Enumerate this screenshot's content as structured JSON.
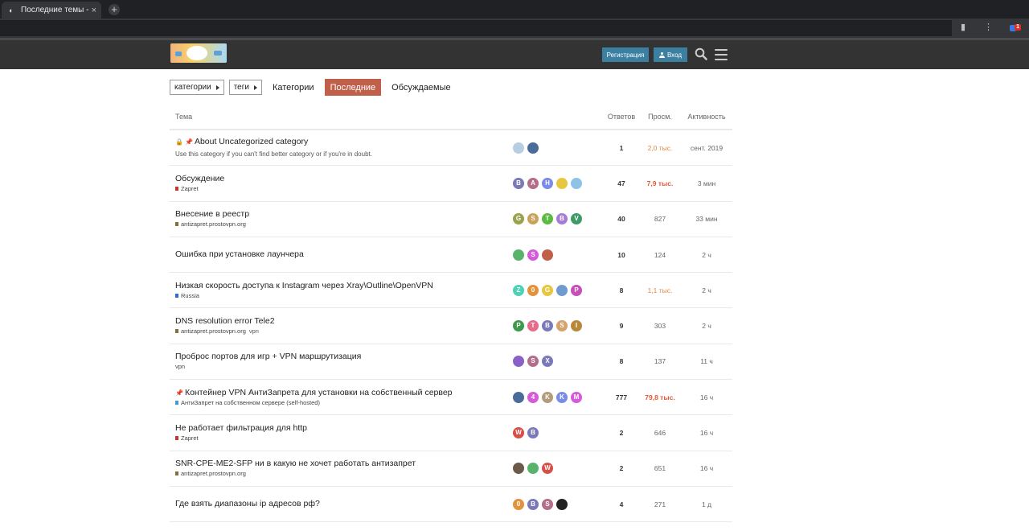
{
  "browser": {
    "tab_title": "Последние темы - NTC",
    "tab_close": "×",
    "new_tab": "+",
    "extension_count": "1"
  },
  "header": {
    "register_label": "Регистрация",
    "login_label": "Вход"
  },
  "nav": {
    "categories_dd": "категории",
    "tags_dd": "теги",
    "links": [
      "Категории",
      "Последние",
      "Обсуждаемые"
    ],
    "active_index": 1
  },
  "table": {
    "headers": {
      "topic": "Тема",
      "replies": "Ответов",
      "views": "Просм.",
      "activity": "Активность"
    },
    "rows": [
      {
        "title": "About Uncategorized category",
        "excerpt": "Use this category if you can't find better category or if you're in doubt.",
        "locked": true,
        "pinned": true,
        "category": "",
        "category_color": "",
        "tag": "",
        "posters": [
          {
            "letter": "",
            "color": "#b7cde3",
            "icon": "avatar-sketch"
          },
          {
            "letter": "",
            "color": "#4a6c9b",
            "icon": "avatar-anime"
          }
        ],
        "replies": "1",
        "views": "2,0 тыс.",
        "views_style": "warm",
        "activity": "сент. 2019"
      },
      {
        "title": "Обсуждение",
        "category": "Zapret",
        "category_color": "#c0392b",
        "posters": [
          {
            "letter": "B",
            "color": "#7b7ab8"
          },
          {
            "letter": "A",
            "color": "#b36e8a"
          },
          {
            "letter": "H",
            "color": "#7b8ce6"
          },
          {
            "letter": "",
            "color": "#e6c73f",
            "icon": "avatar-pixel"
          },
          {
            "letter": "",
            "color": "#8fc3e6",
            "icon": "avatar-pixel2"
          }
        ],
        "replies": "47",
        "views": "7,9 тыс.",
        "views_style": "hot",
        "activity": "3 мин"
      },
      {
        "title": "Внесение в реестр",
        "category": "antizapret.prostovpn.org",
        "category_color": "#8a6b3e",
        "posters": [
          {
            "letter": "G",
            "color": "#9ba14c"
          },
          {
            "letter": "S",
            "color": "#c9a35a"
          },
          {
            "letter": "T",
            "color": "#5aba42"
          },
          {
            "letter": "B",
            "color": "#a57bd8"
          },
          {
            "letter": "V",
            "color": "#3e9a6b"
          }
        ],
        "replies": "40",
        "views": "827",
        "views_style": "",
        "activity": "33 мин"
      },
      {
        "title": "Ошибка при установке лаунчера",
        "category": "",
        "category_color": "",
        "posters": [
          {
            "letter": "",
            "color": "#5ab36a",
            "icon": "avatar-pixel3"
          },
          {
            "letter": "S",
            "color": "#d55bd8"
          },
          {
            "letter": "",
            "color": "#c0604a",
            "icon": "avatar-box"
          }
        ],
        "replies": "10",
        "views": "124",
        "views_style": "",
        "activity": "2 ч"
      },
      {
        "title": "Низкая скорость доступа к Instagram через Xray\\Outline\\OpenVPN",
        "category": "Russia",
        "category_color": "#2c6dd4",
        "posters": [
          {
            "letter": "Z",
            "color": "#4fd1b5"
          },
          {
            "letter": "0",
            "color": "#e2923b"
          },
          {
            "letter": "G",
            "color": "#e6c73f"
          },
          {
            "letter": "",
            "color": "#6f9bd1",
            "icon": "avatar-photo"
          },
          {
            "letter": "P",
            "color": "#c84fb8"
          }
        ],
        "replies": "8",
        "views": "1,1 тыс.",
        "views_style": "warm",
        "activity": "2 ч"
      },
      {
        "title": "DNS resolution error Tele2",
        "category": "antizapret.prostovpn.org",
        "category_color": "#8a6b3e",
        "tag": "vpn",
        "posters": [
          {
            "letter": "P",
            "color": "#3e9a4b"
          },
          {
            "letter": "T",
            "color": "#e56c8a"
          },
          {
            "letter": "B",
            "color": "#7b7ab8"
          },
          {
            "letter": "S",
            "color": "#d6a26b"
          },
          {
            "letter": "I",
            "color": "#b8893a"
          }
        ],
        "replies": "9",
        "views": "303",
        "views_style": "",
        "activity": "2 ч"
      },
      {
        "title": "Проброс портов для игр + VPN маршрутизация",
        "category": "",
        "category_color": "",
        "tag": "vpn",
        "posters": [
          {
            "letter": "",
            "color": "#8a62c7",
            "icon": "avatar-pixel4"
          },
          {
            "letter": "S",
            "color": "#b36e8a"
          },
          {
            "letter": "X",
            "color": "#7b7ab8"
          }
        ],
        "replies": "8",
        "views": "137",
        "views_style": "",
        "activity": "11 ч"
      },
      {
        "title": "Контейнер VPN АнтиЗапрета для установки на собственный сервер",
        "pinned": true,
        "category": "АнтиЗапрет на собственном сервере (self-hosted)",
        "category_color": "#3c9ad4",
        "posters": [
          {
            "letter": "",
            "color": "#4a6c9b",
            "icon": "avatar-anime"
          },
          {
            "letter": "4",
            "color": "#d55bd8"
          },
          {
            "letter": "K",
            "color": "#b39c7b"
          },
          {
            "letter": "K",
            "color": "#7b8ce6"
          },
          {
            "letter": "M",
            "color": "#d55bd8"
          }
        ],
        "replies": "777",
        "views": "79,8 тыс.",
        "views_style": "hot",
        "activity": "16 ч"
      },
      {
        "title": "Не работает фильтрация для http",
        "category": "Zapret",
        "category_color": "#c0392b",
        "posters": [
          {
            "letter": "W",
            "color": "#d6504a"
          },
          {
            "letter": "B",
            "color": "#7b7ab8"
          }
        ],
        "replies": "2",
        "views": "646",
        "views_style": "",
        "activity": "16 ч"
      },
      {
        "title": "SNR-CPE-ME2-SFP ни в какую не хочет работать антизапрет",
        "category": "antizapret.prostovpn.org",
        "category_color": "#8a6b3e",
        "posters": [
          {
            "letter": "",
            "color": "#6b5a4a",
            "icon": "avatar-photo2"
          },
          {
            "letter": "",
            "color": "#5ab36a",
            "icon": "avatar-pixel5"
          },
          {
            "letter": "W",
            "color": "#d6504a"
          }
        ],
        "replies": "2",
        "views": "651",
        "views_style": "",
        "activity": "16 ч"
      },
      {
        "title": "Где взять диапазоны ip адресов рф?",
        "category": "",
        "category_color": "",
        "posters": [
          {
            "letter": "0",
            "color": "#e2923b"
          },
          {
            "letter": "B",
            "color": "#7b7ab8"
          },
          {
            "letter": "S",
            "color": "#b36e8a"
          },
          {
            "letter": "",
            "color": "#222222",
            "icon": "avatar-dark"
          }
        ],
        "replies": "4",
        "views": "271",
        "views_style": "",
        "activity": "1 д"
      }
    ]
  }
}
